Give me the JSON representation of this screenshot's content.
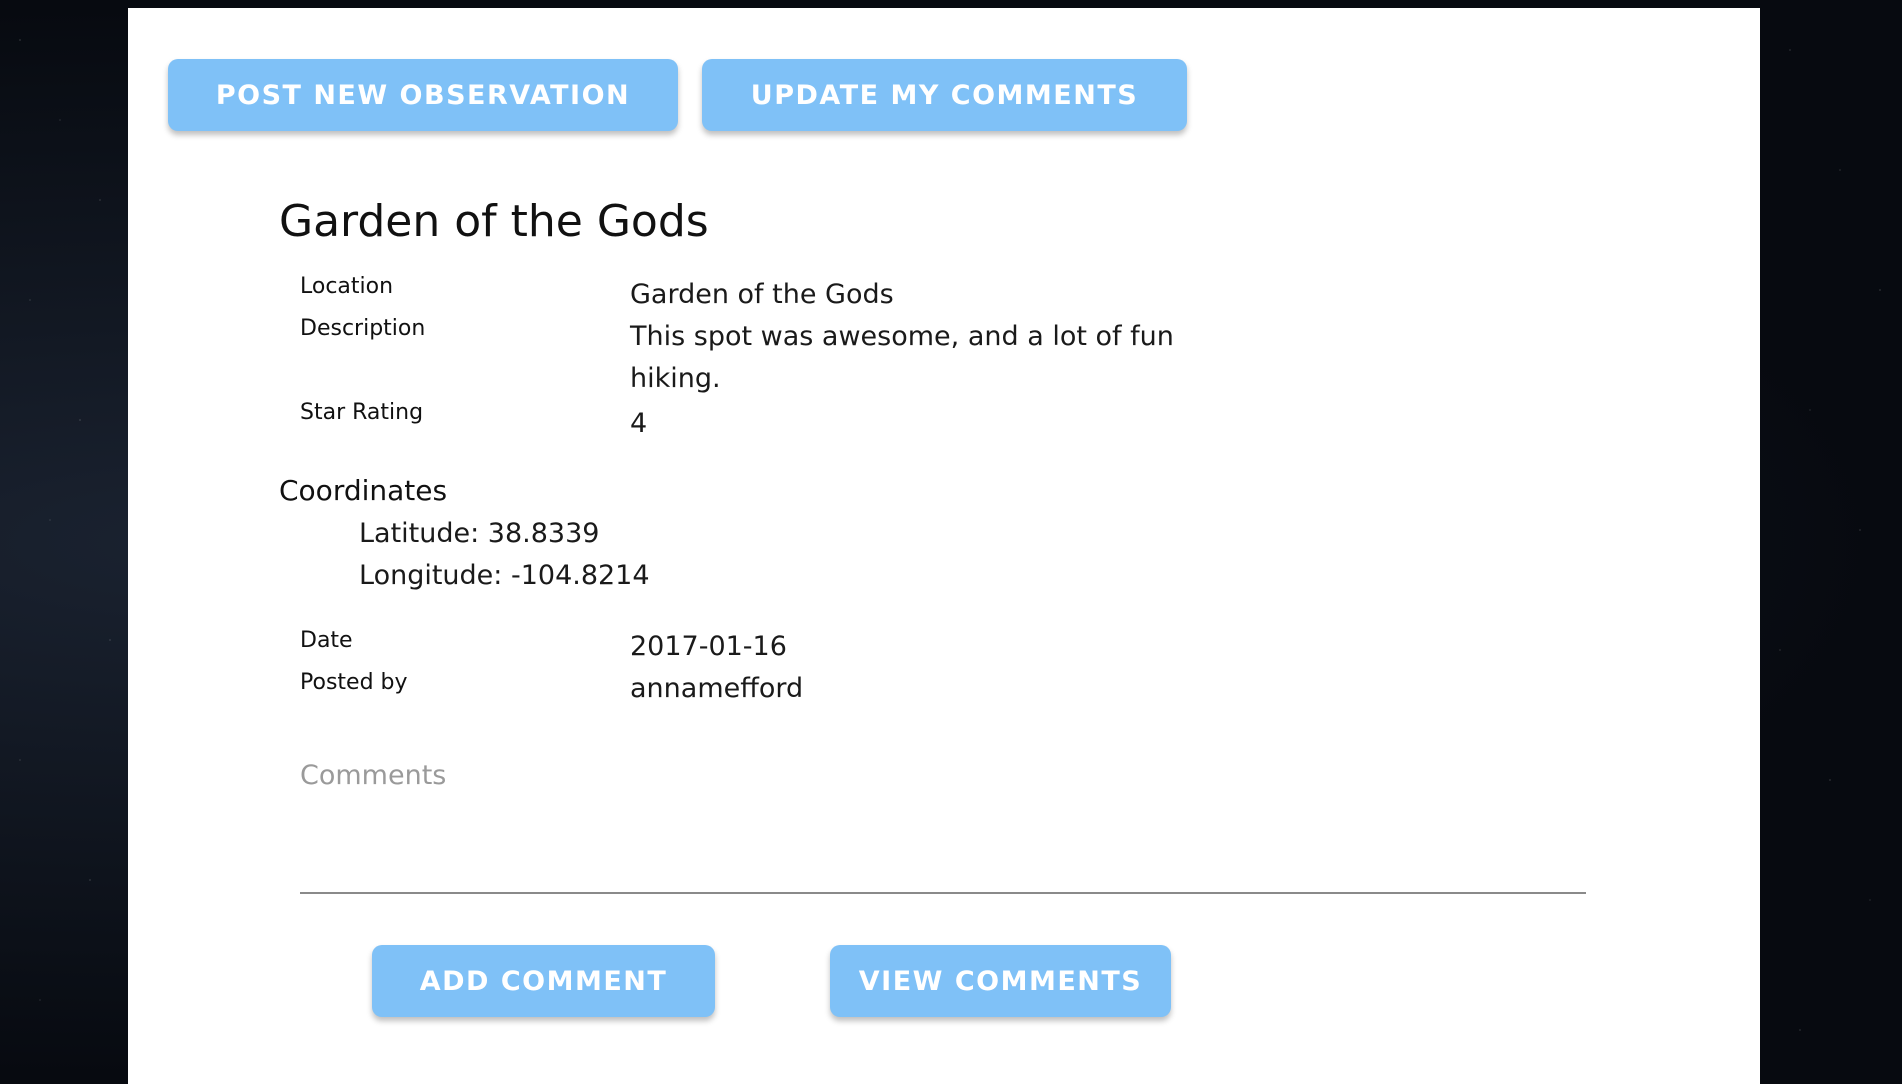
{
  "toolbar": {
    "post_new_observation": "POST NEW OBSERVATION",
    "update_my_comments": "UPDATE MY COMMENTS"
  },
  "observation": {
    "title": "Garden of the Gods",
    "fields": {
      "location_label": "Location",
      "location_value": "Garden of the Gods",
      "description_label": "Description",
      "description_value": "This spot was awesome, and a lot of fun hiking.",
      "star_rating_label": "Star Rating",
      "star_rating_value": "4"
    },
    "coordinates": {
      "heading": "Coordinates",
      "latitude": "Latitude: 38.8339",
      "longitude": "Longitude: -104.8214"
    },
    "meta": {
      "date_label": "Date",
      "date_value": "2017-01-16",
      "posted_by_label": "Posted by",
      "posted_by_value": "annamefford"
    }
  },
  "comments": {
    "placeholder": "Comments",
    "add_label": "ADD COMMENT",
    "view_label": "VIEW COMMENTS"
  },
  "colors": {
    "button_bg": "#7fc1f7",
    "button_text": "#ffffff",
    "panel_bg": "#ffffff"
  }
}
